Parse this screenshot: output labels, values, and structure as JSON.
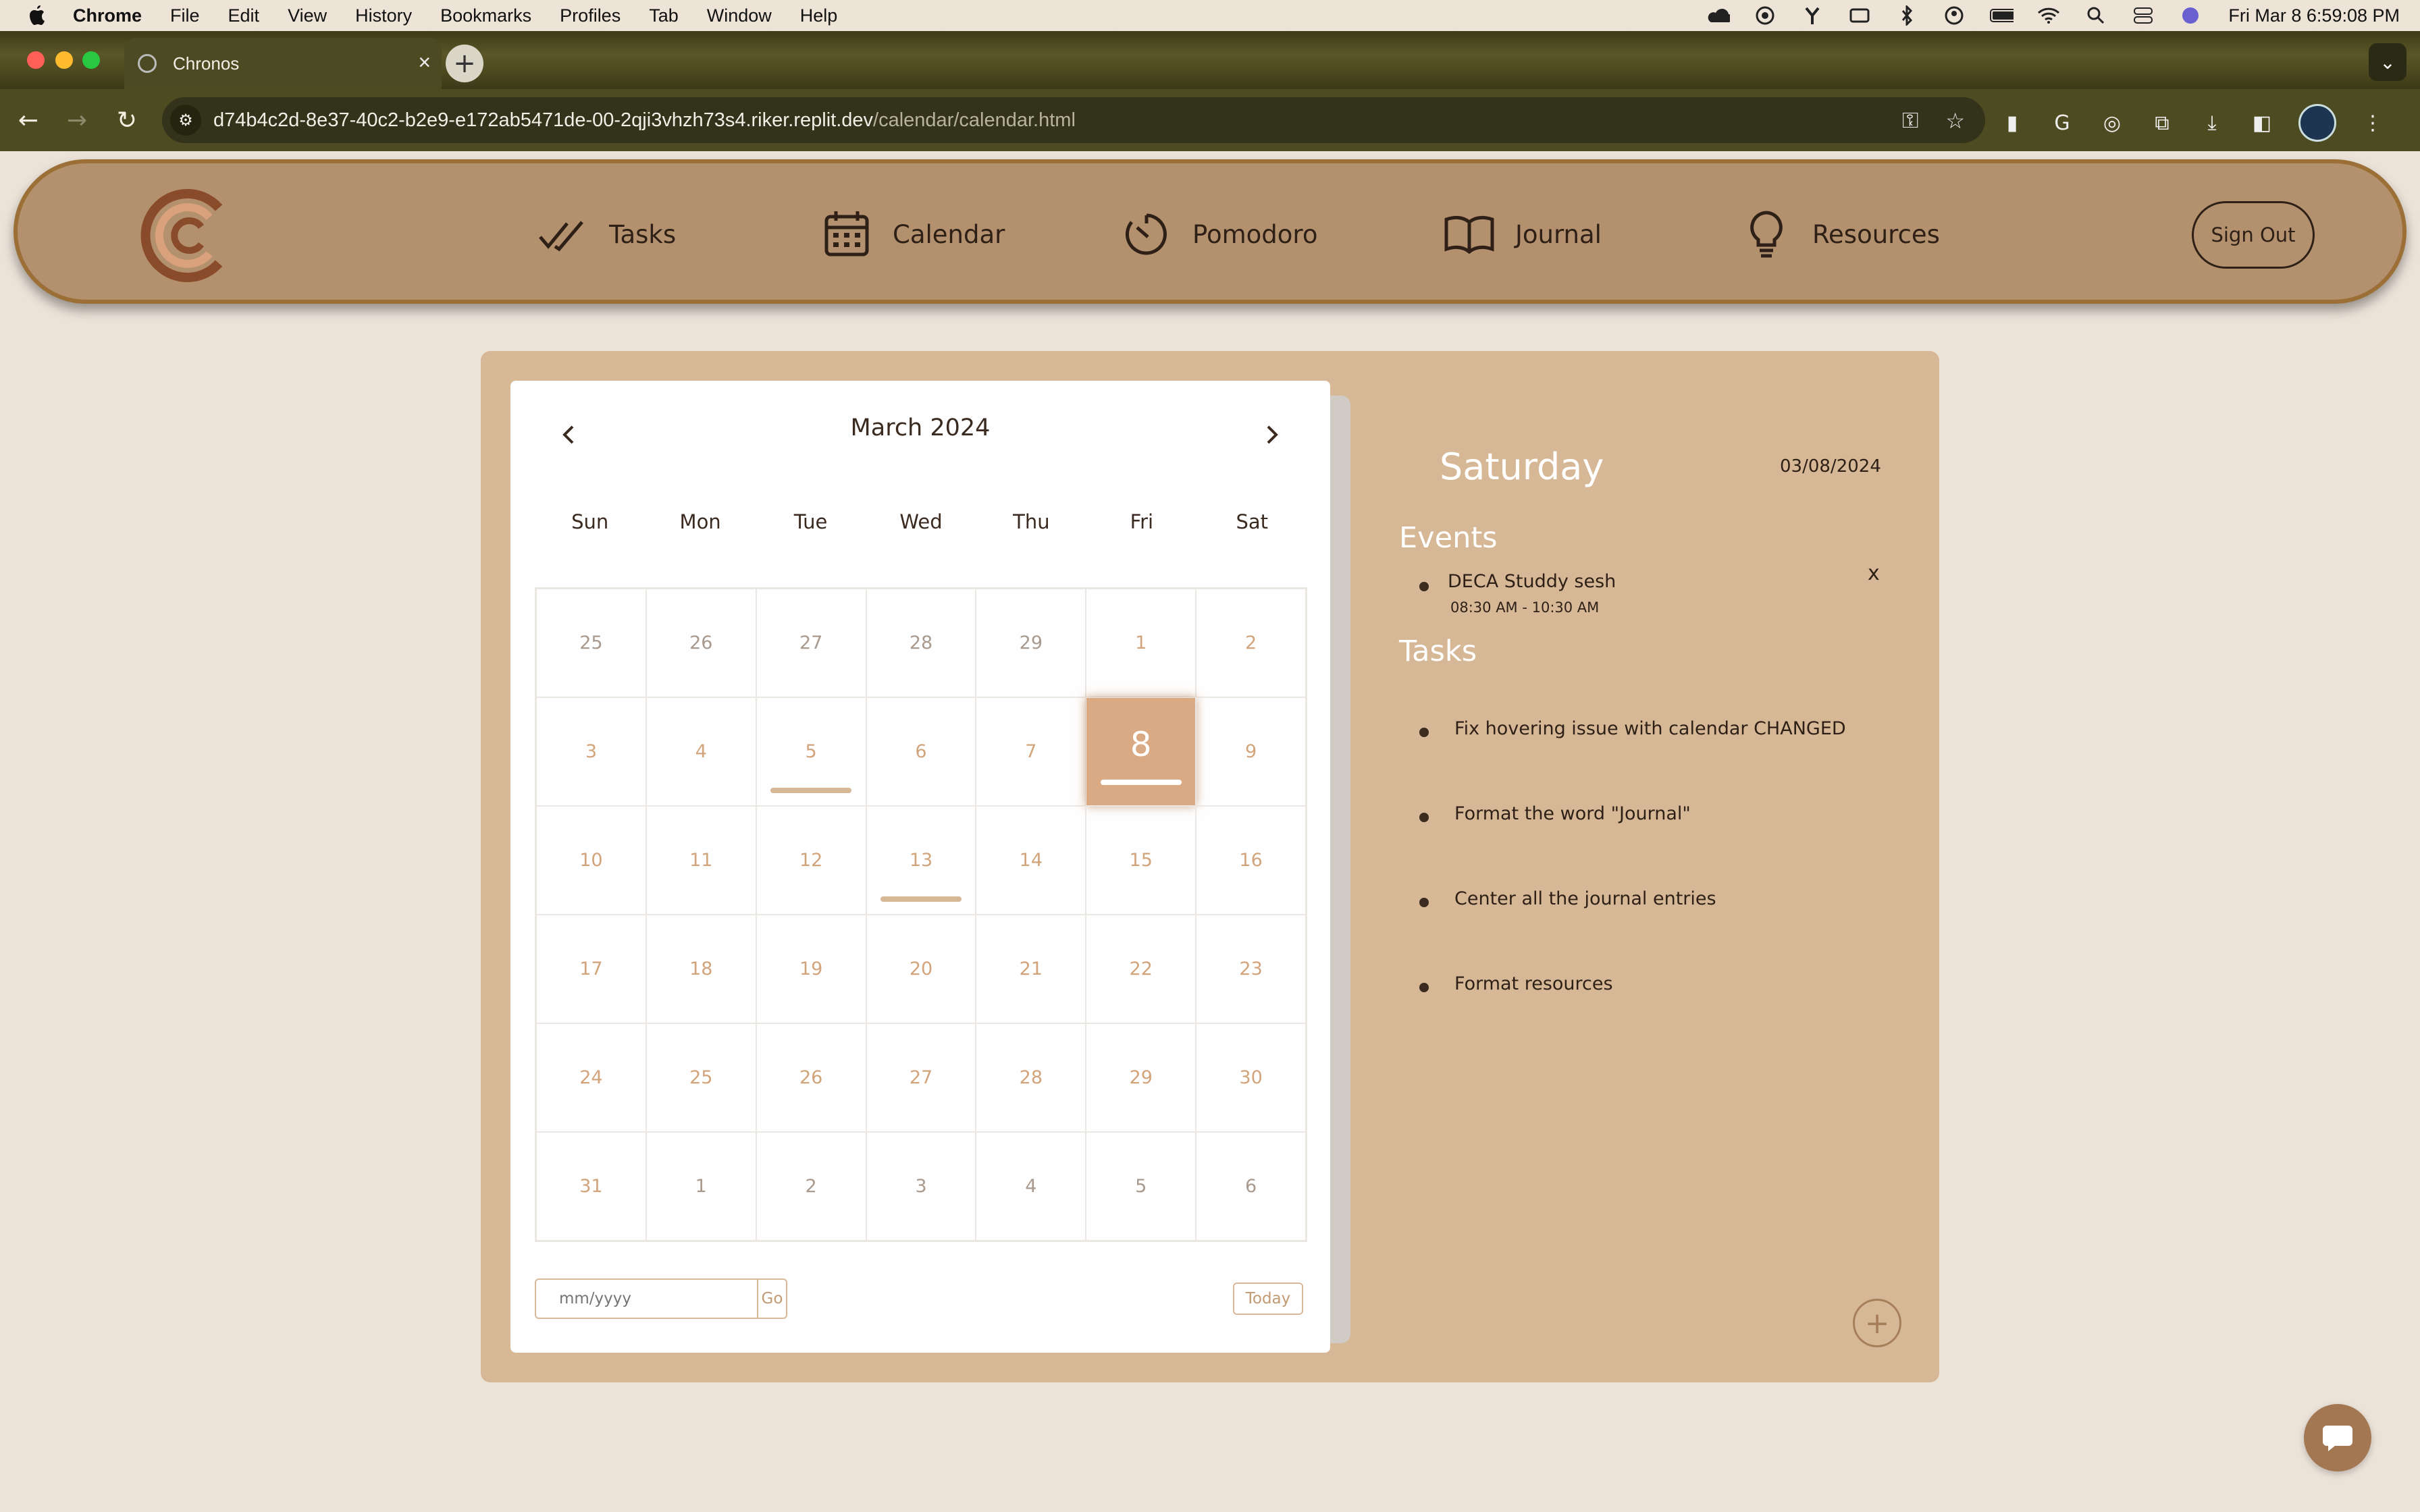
{
  "menubar": {
    "app": "Chrome",
    "items": [
      "File",
      "Edit",
      "View",
      "History",
      "Bookmarks",
      "Profiles",
      "Tab",
      "Window",
      "Help"
    ],
    "clock": "Fri Mar 8  6:59:08 PM"
  },
  "browser": {
    "tab_title": "Chronos",
    "url_host": "d74b4c2d-8e37-40c2-b2e9-e172ab5471de-00-2qji3vhzh73s4.riker.replit.dev",
    "url_path": "/calendar/calendar.html"
  },
  "nav": {
    "items": [
      {
        "label": "Tasks",
        "icon": "double-check-icon"
      },
      {
        "label": "Calendar",
        "icon": "calendar-icon"
      },
      {
        "label": "Pomodoro",
        "icon": "timer-icon"
      },
      {
        "label": "Journal",
        "icon": "open-book-icon"
      },
      {
        "label": "Resources",
        "icon": "lightbulb-icon"
      }
    ],
    "sign_out": "Sign Out"
  },
  "calendar": {
    "month_title": "March 2024",
    "weekdays": [
      "Sun",
      "Mon",
      "Tue",
      "Wed",
      "Thu",
      "Fri",
      "Sat"
    ],
    "weeks": [
      [
        {
          "d": "25",
          "other": true
        },
        {
          "d": "26",
          "other": true
        },
        {
          "d": "27",
          "other": true
        },
        {
          "d": "28",
          "other": true
        },
        {
          "d": "29",
          "other": true
        },
        {
          "d": "1"
        },
        {
          "d": "2"
        }
      ],
      [
        {
          "d": "3"
        },
        {
          "d": "4"
        },
        {
          "d": "5",
          "marked": true
        },
        {
          "d": "6"
        },
        {
          "d": "7"
        },
        {
          "d": "8",
          "selected": true,
          "marked": true
        },
        {
          "d": "9"
        }
      ],
      [
        {
          "d": "10"
        },
        {
          "d": "11"
        },
        {
          "d": "12"
        },
        {
          "d": "13",
          "marked": true
        },
        {
          "d": "14"
        },
        {
          "d": "15"
        },
        {
          "d": "16"
        }
      ],
      [
        {
          "d": "17"
        },
        {
          "d": "18"
        },
        {
          "d": "19"
        },
        {
          "d": "20"
        },
        {
          "d": "21"
        },
        {
          "d": "22"
        },
        {
          "d": "23"
        }
      ],
      [
        {
          "d": "24"
        },
        {
          "d": "25"
        },
        {
          "d": "26"
        },
        {
          "d": "27"
        },
        {
          "d": "28"
        },
        {
          "d": "29"
        },
        {
          "d": "30"
        }
      ],
      [
        {
          "d": "31"
        },
        {
          "d": "1",
          "other": true
        },
        {
          "d": "2",
          "other": true
        },
        {
          "d": "3",
          "other": true
        },
        {
          "d": "4",
          "other": true
        },
        {
          "d": "5",
          "other": true
        },
        {
          "d": "6",
          "other": true
        }
      ]
    ],
    "date_placeholder": "mm/yyyy",
    "go_label": "Go",
    "today_label": "Today"
  },
  "details": {
    "day_name": "Saturday",
    "date": "03/08/2024",
    "events_title": "Events",
    "events": [
      {
        "name": "DECA Studdy sesh",
        "time": "08:30 AM - 10:30 AM",
        "delete_label": "x"
      }
    ],
    "tasks_title": "Tasks",
    "tasks": [
      "Fix hovering issue with calendar CHANGED",
      "Format the word \"Journal\"",
      "Center all the journal entries",
      "Format resources"
    ],
    "add_label": "+"
  },
  "colors": {
    "accent": "#d9aa83",
    "panel": "#d6b896",
    "header": "#b3906e",
    "text": "#2e2016"
  }
}
